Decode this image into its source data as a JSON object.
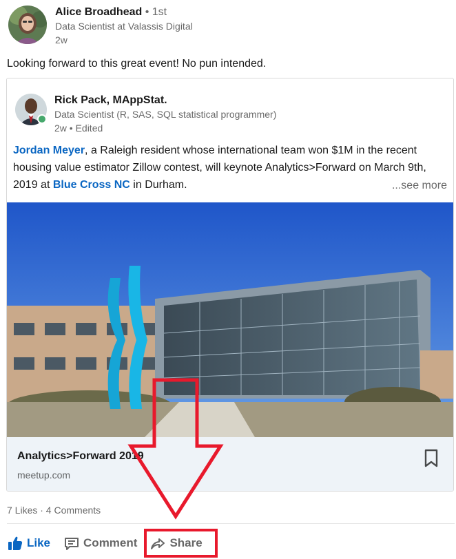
{
  "author": {
    "name": "Alice Broadhead",
    "degree": "• 1st",
    "headline": "Data Scientist at Valassis Digital",
    "time": "2w"
  },
  "commentary": "Looking forward to this great event! No pun intended.",
  "shared": {
    "author": {
      "name": "Rick Pack, MAppStat.",
      "headline": "Data Scientist (R, SAS, SQL statistical programmer)",
      "time": "2w • Edited"
    },
    "text": {
      "mention_1": "Jordan Meyer",
      "part_1": ", a Raleigh resident whose international team won $1M in the recent housing value estimator Zillow contest, will keynote Analytics>Forward on March 9th, 2019 at ",
      "mention_2": "Blue Cross NC",
      "part_2": " in Durham.",
      "see_more": "...see more"
    },
    "link": {
      "title": "Analytics>Forward 2019",
      "domain": "meetup.com",
      "image_icon": "building-photo"
    }
  },
  "social": {
    "counts": "7 Likes · 4 Comments"
  },
  "actions": {
    "like": "Like",
    "comment": "Comment",
    "share": "Share"
  },
  "colors": {
    "link_blue": "#0a66c2",
    "annotation_red": "#e8192c",
    "caption_bg": "#eef3f8"
  }
}
